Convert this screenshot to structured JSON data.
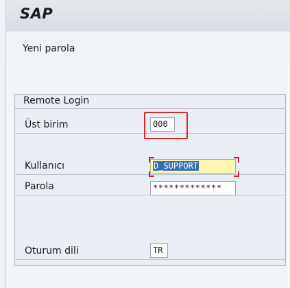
{
  "app": {
    "title": "SAP"
  },
  "subtitle": "Yeni parola",
  "group": {
    "title": "Remote Login",
    "fields": {
      "client": {
        "label": "Üst birim",
        "value": "000"
      },
      "user": {
        "label": "Kullanıcı",
        "value": "D_SUPPORT"
      },
      "password": {
        "label": "Parola",
        "value": "*************"
      },
      "language": {
        "label": "Oturum dili",
        "value": "TR"
      }
    }
  },
  "colors": {
    "highlight": "#d9262b",
    "focused_field": "#fef7b1",
    "selection": "#3a6cb5"
  }
}
